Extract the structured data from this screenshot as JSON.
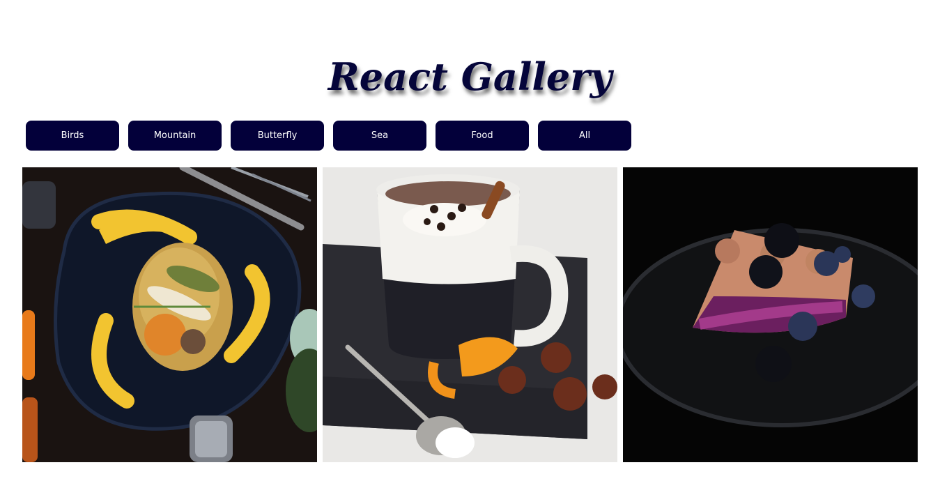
{
  "header": {
    "title": "React Gallery"
  },
  "filters": [
    {
      "label": "Birds"
    },
    {
      "label": "Mountain"
    },
    {
      "label": "Butterfly"
    },
    {
      "label": "Sea"
    },
    {
      "label": "Food"
    },
    {
      "label": "All"
    }
  ],
  "colors": {
    "button_bg": "#03003a",
    "title_color": "#05053a"
  },
  "gallery": {
    "items": [
      {
        "icon": "plated-dish-image"
      },
      {
        "icon": "hot-chocolate-image"
      },
      {
        "icon": "berry-pie-image"
      }
    ]
  }
}
